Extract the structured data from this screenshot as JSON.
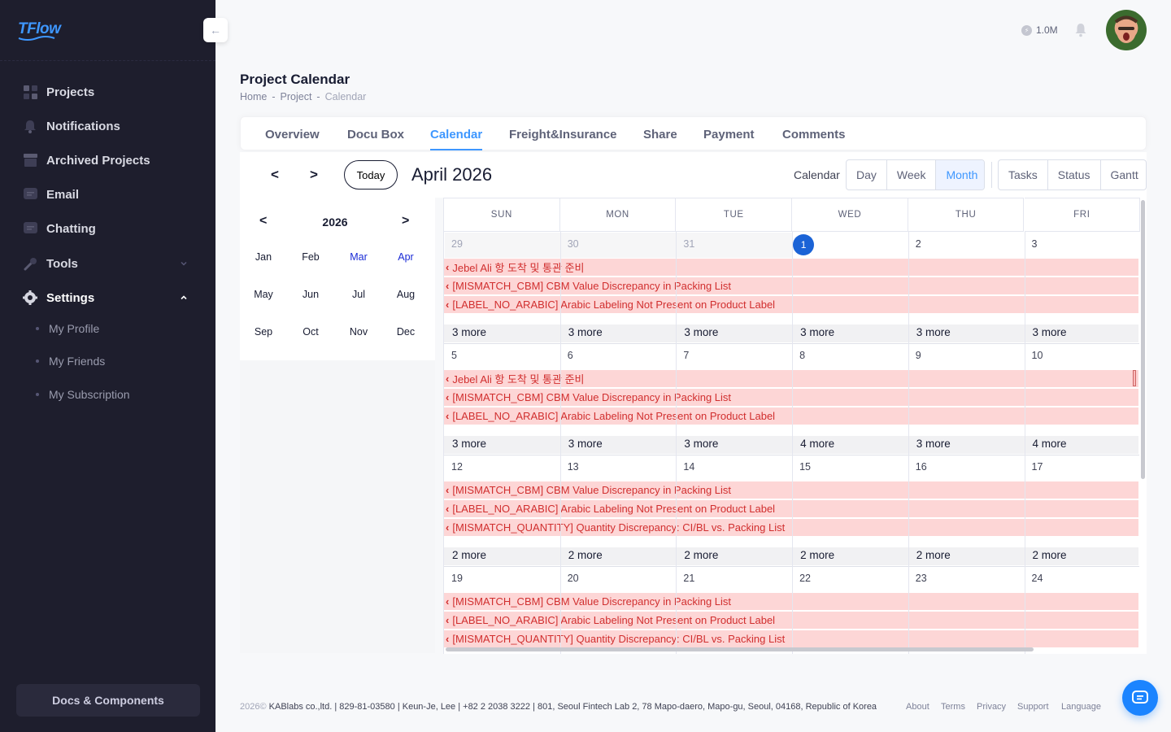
{
  "app": {
    "logo_text": "TFlow",
    "accent": "#3e97ff"
  },
  "sidebar": {
    "items": [
      {
        "label": "Projects",
        "icon": "grid-icon"
      },
      {
        "label": "Notifications",
        "icon": "bell-icon"
      },
      {
        "label": "Archived Projects",
        "icon": "archive-icon"
      },
      {
        "label": "Email",
        "icon": "message-icon"
      },
      {
        "label": "Chatting",
        "icon": "chat-icon"
      },
      {
        "label": "Tools",
        "icon": "wrench-icon",
        "expanded": false
      },
      {
        "label": "Settings",
        "icon": "gear-icon",
        "expanded": true
      }
    ],
    "settings_sub": [
      "My Profile",
      "My Friends",
      "My Subscription"
    ],
    "docs_button": "Docs & Components"
  },
  "header": {
    "credits": "1.0M"
  },
  "page": {
    "title": "Project Calendar",
    "breadcrumb": [
      "Home",
      "Project",
      "Calendar"
    ],
    "breadcrumb_sep": "-"
  },
  "tabs": [
    {
      "label": "Overview",
      "active": false
    },
    {
      "label": "Docu Box",
      "active": false
    },
    {
      "label": "Calendar",
      "active": true
    },
    {
      "label": "Freight&Insurance",
      "active": false
    },
    {
      "label": "Share",
      "active": false
    },
    {
      "label": "Payment",
      "active": false
    },
    {
      "label": "Comments",
      "active": false
    }
  ],
  "toolbar": {
    "prev": "<",
    "next": ">",
    "today": "Today",
    "month_title": "April 2026",
    "calendar_label": "Calendar",
    "views": [
      {
        "label": "Day"
      },
      {
        "label": "Week"
      },
      {
        "label": "Month",
        "selected": true
      }
    ],
    "modes": [
      {
        "label": "Tasks"
      },
      {
        "label": "Status"
      },
      {
        "label": "Gantt"
      }
    ]
  },
  "mini_calendar": {
    "prev": "<",
    "next": ">",
    "year": "2026",
    "months": [
      "Jan",
      "Feb",
      "Mar",
      "Apr",
      "May",
      "Jun",
      "Jul",
      "Aug",
      "Sep",
      "Oct",
      "Nov",
      "Dec"
    ],
    "highlighted": [
      "Mar",
      "Apr"
    ]
  },
  "calendar": {
    "weekdays": [
      "SUN",
      "MON",
      "TUE",
      "WED",
      "THU",
      "FRI"
    ],
    "weeks": [
      {
        "days": [
          "29",
          "30",
          "31",
          "1",
          "2",
          "3"
        ],
        "prev_month_days": 3,
        "today_index": 3,
        "events": [
          "Jebel Ali 항 도착 및 통관 준비",
          "[MISMATCH_CBM] CBM Value Discrepancy in Packing List",
          "[LABEL_NO_ARABIC] Arabic Labeling Not Present on Product Label"
        ],
        "more": [
          "3 more",
          "3 more",
          "3 more",
          "3 more",
          "3 more",
          "3 more"
        ]
      },
      {
        "days": [
          "5",
          "6",
          "7",
          "8",
          "9",
          "10"
        ],
        "events": [
          "Jebel Ali 항 도착 및 통관 준비",
          "[MISMATCH_CBM] CBM Value Discrepancy in Packing List",
          "[LABEL_NO_ARABIC] Arabic Labeling Not Present on Product Label"
        ],
        "more": [
          "3 more",
          "3 more",
          "3 more",
          "4 more",
          "3 more",
          "4 more"
        ]
      },
      {
        "days": [
          "12",
          "13",
          "14",
          "15",
          "16",
          "17"
        ],
        "events": [
          "[MISMATCH_CBM] CBM Value Discrepancy in Packing List",
          "[LABEL_NO_ARABIC] Arabic Labeling Not Present on Product Label",
          "[MISMATCH_QUANTITY] Quantity Discrepancy: CI/BL vs. Packing List"
        ],
        "more": [
          "2 more",
          "2 more",
          "2 more",
          "2 more",
          "2 more",
          "2 more"
        ]
      },
      {
        "days": [
          "19",
          "20",
          "21",
          "22",
          "23",
          "24"
        ],
        "events": [
          "[MISMATCH_CBM] CBM Value Discrepancy in Packing List",
          "[LABEL_NO_ARABIC] Arabic Labeling Not Present on Product Label",
          "[MISMATCH_QUANTITY] Quantity Discrepancy: CI/BL vs. Packing List"
        ],
        "more": []
      }
    ],
    "event_color": "#fdd6d6",
    "event_text_color": "#d12f2f"
  },
  "footer": {
    "year": "2026©",
    "company": "KABlabs co.,ltd. | 829-81-03580 | Keun-Je, Lee | +82 2 2038 3222 | 801, Seoul Fintech Lab 2, 78 Mapo-daero, Mapo-gu, Seoul, 04168, Republic of Korea",
    "links": [
      "About",
      "Terms",
      "Privacy",
      "Support",
      "Language"
    ]
  }
}
